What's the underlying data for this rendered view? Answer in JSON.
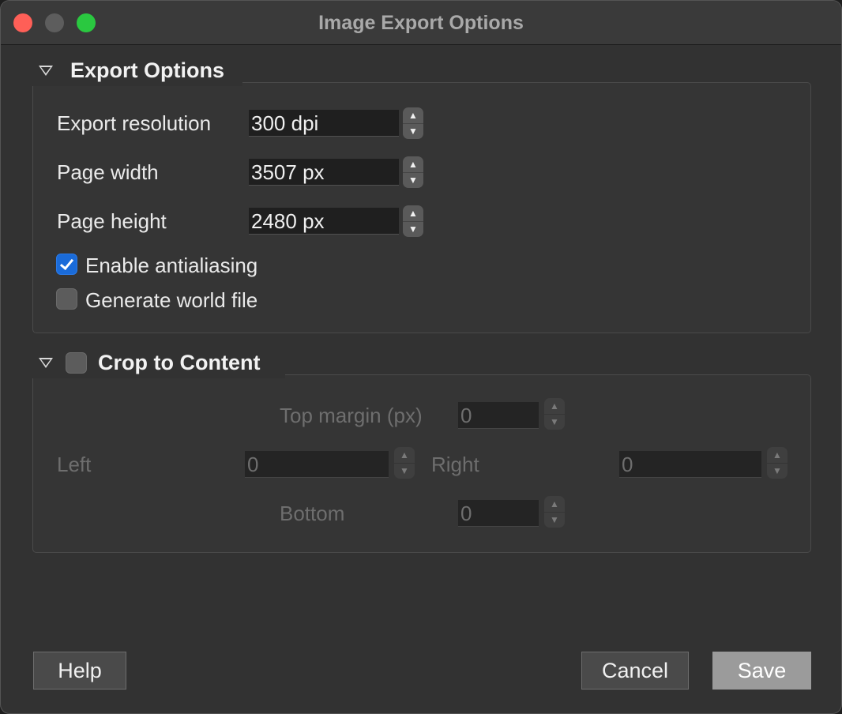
{
  "window": {
    "title": "Image Export Options"
  },
  "export_options": {
    "header": "Export Options",
    "resolution": {
      "label": "Export resolution",
      "value": "300 dpi"
    },
    "page_width": {
      "label": "Page width",
      "value": "3507 px"
    },
    "page_height": {
      "label": "Page height",
      "value": "2480 px"
    },
    "antialiasing": {
      "label": "Enable antialiasing",
      "checked": true
    },
    "world_file": {
      "label": "Generate world file",
      "checked": false
    }
  },
  "crop": {
    "header": "Crop to Content",
    "checked": false,
    "top": {
      "label": "Top margin (px)",
      "value": "0"
    },
    "left": {
      "label": "Left",
      "value": "0"
    },
    "right": {
      "label": "Right",
      "value": "0"
    },
    "bottom": {
      "label": "Bottom",
      "value": "0"
    }
  },
  "buttons": {
    "help": "Help",
    "cancel": "Cancel",
    "save": "Save"
  },
  "icons": {
    "spin_up": "chevron-up-icon",
    "spin_down": "chevron-down-icon",
    "collapse": "triangle-down-icon"
  },
  "colors": {
    "accent": "#1a6bd9",
    "close": "#fe5f57",
    "maximize": "#2ac840"
  }
}
